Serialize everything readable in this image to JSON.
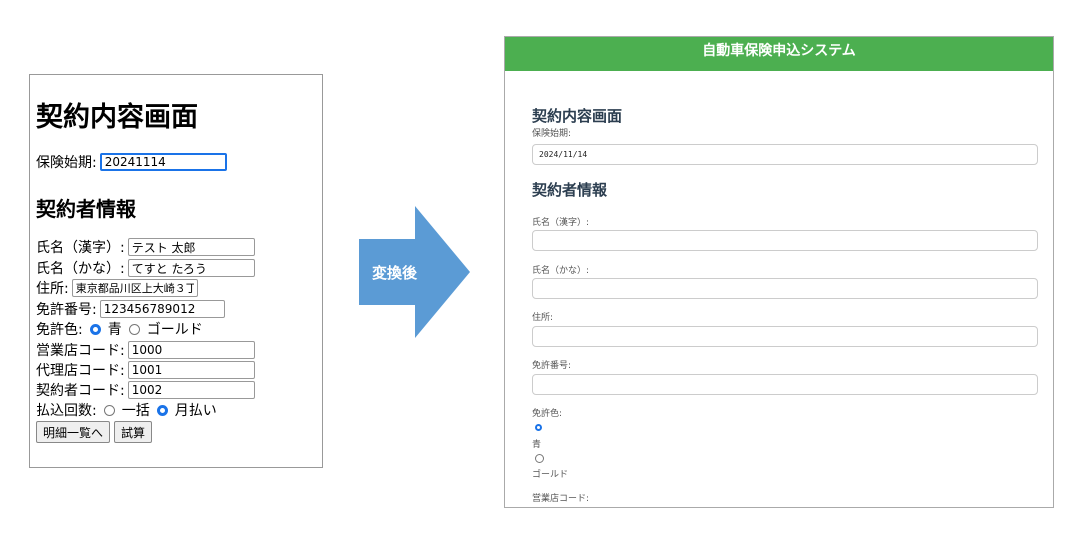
{
  "before": {
    "title": "契約内容画面",
    "start_label": "保険始期:",
    "start_value": "20241114",
    "section": "契約者情報",
    "name_kanji_label": "氏名（漢字）:",
    "name_kanji_value": "テスト 太郎",
    "name_kana_label": "氏名（かな）:",
    "name_kana_value": "てすと たろう",
    "address_label": "住所:",
    "address_value": "東京都品川区上大崎３丁",
    "license_no_label": "免許番号:",
    "license_no_value": "123456789012",
    "license_color_label": "免許色:",
    "license_color_options": [
      "青",
      "ゴールド"
    ],
    "license_color_selected": "青",
    "branch_label": "営業店コード:",
    "branch_value": "1000",
    "agent_label": "代理店コード:",
    "agent_value": "1001",
    "contractor_label": "契約者コード:",
    "contractor_value": "1002",
    "payment_label": "払込回数:",
    "payment_options": [
      "一括",
      "月払い"
    ],
    "payment_selected": "月払い",
    "btn_detail": "明細一覧へ",
    "btn_calc": "試算"
  },
  "arrow": {
    "label": "変換後",
    "color": "#5b9bd5"
  },
  "after": {
    "app_title": "自動車保険申込システム",
    "header_color": "#4caf50",
    "title": "契約内容画面",
    "start_label": "保険始期:",
    "start_value": "2024/11/14",
    "section": "契約者情報",
    "name_kanji_label": "氏名（漢字）:",
    "name_kana_label": "氏名（かな）:",
    "address_label": "住所:",
    "license_no_label": "免許番号:",
    "license_color_label": "免許色:",
    "license_color_options": [
      "青",
      "ゴールド"
    ],
    "license_color_selected": "青",
    "branch_label": "営業店コード:"
  }
}
